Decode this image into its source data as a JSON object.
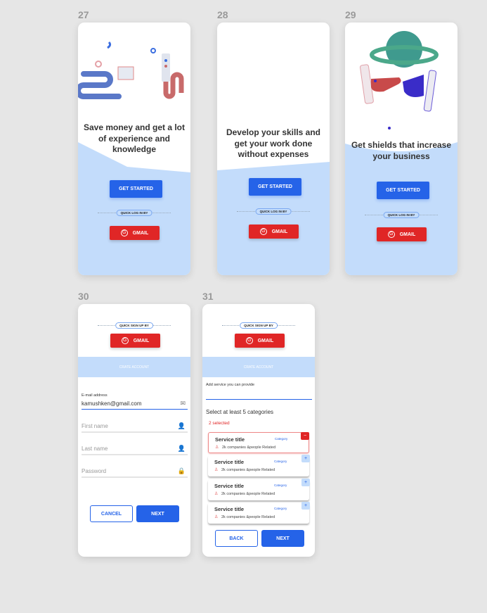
{
  "colors": {
    "primary": "#2563e8",
    "gmail": "#e02626",
    "light_blue": "#c3dcfb",
    "canvas": "#e6e6e6"
  },
  "frames": [
    {
      "number": "27",
      "title": "Save money and get a lot of experience and knowledge",
      "cta": "GET STARTED",
      "quick_label": "QUICK LOG IN BY",
      "gmail": "GMAIL",
      "g_icon": "G"
    },
    {
      "number": "28",
      "title": "Develop your skills and get your work done without expenses",
      "cta": "GET STARTED",
      "quick_label": "QUICK LOG IN BY",
      "gmail": "GMAIL",
      "g_icon": "G"
    },
    {
      "number": "29",
      "title": "Get shields that increase your business",
      "cta": "GET STARTED",
      "quick_label": "QUICK LOG IN BY",
      "gmail": "GMAIL",
      "g_icon": "G"
    }
  ],
  "signup": {
    "number": "30",
    "quick_label": "QUICK SIGN UP BY",
    "gmail": "GMAIL",
    "g_icon": "G",
    "band": "CRATE ACCOUNT",
    "email_label": "E-mail address",
    "email_value": "kamushken@gmail.com",
    "first_name": "First name",
    "last_name": "Last name",
    "password": "Password",
    "cancel": "CANCEL",
    "next": "NEXT",
    "icons": {
      "email": "✉",
      "first": "👤",
      "last": "👤",
      "password": "🔒"
    }
  },
  "services": {
    "number": "31",
    "quick_label": "QUICK SIGN UP BY",
    "gmail": "GMAIL",
    "g_icon": "G",
    "band": "CRATE ACCOUNT",
    "service_label": "Add service you can provide",
    "service_value": "",
    "select_label": "Select at least 5 categories",
    "selected": "2 selected",
    "items": [
      {
        "title": "Service title",
        "category": "Category",
        "related": "2k companies &people Related",
        "toggle": "−",
        "selected": true
      },
      {
        "title": "Service title",
        "category": "Category",
        "related": "2k companies &people Related",
        "toggle": "+",
        "selected": false
      },
      {
        "title": "Service title",
        "category": "Category",
        "related": "2k companies &people Related",
        "toggle": "+",
        "selected": false
      },
      {
        "title": "Service title",
        "category": "Category",
        "related": "2k companies &people Related",
        "toggle": "+",
        "selected": false
      }
    ],
    "back": "BACK",
    "next": "NEXT"
  }
}
